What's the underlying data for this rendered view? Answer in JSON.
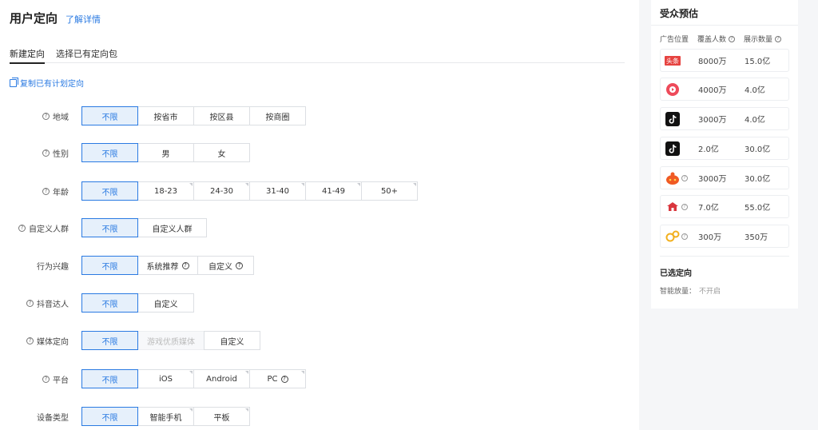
{
  "header": {
    "title": "用户定向",
    "learn_more": "了解详情"
  },
  "tabs": [
    {
      "label": "新建定向"
    },
    {
      "label": "选择已有定向包"
    }
  ],
  "copy_link": "复制已有计划定向",
  "rows": {
    "region": {
      "label": "地域",
      "options": [
        "不限",
        "按省市",
        "按区县",
        "按商圈"
      ]
    },
    "gender": {
      "label": "性别",
      "options": [
        "不限",
        "男",
        "女"
      ]
    },
    "age": {
      "label": "年龄",
      "options": [
        "不限",
        "18-23",
        "24-30",
        "31-40",
        "41-49",
        "50+"
      ]
    },
    "custom_crowd": {
      "label": "自定义人群",
      "options": [
        "不限",
        "自定义人群"
      ]
    },
    "behavior": {
      "label": "行为兴趣",
      "options": [
        "不限",
        "系统推荐",
        "自定义"
      ]
    },
    "douyin_kol": {
      "label": "抖音达人",
      "options": [
        "不限",
        "自定义"
      ]
    },
    "media": {
      "label": "媒体定向",
      "options": [
        "不限",
        "游戏优质媒体",
        "自定义"
      ]
    },
    "platform": {
      "label": "平台",
      "options": [
        "不限",
        "iOS",
        "Android",
        "PC"
      ]
    },
    "device": {
      "label": "设备类型",
      "options": [
        "不限",
        "智能手机",
        "平板"
      ]
    }
  },
  "help_glyph": "?",
  "audience": {
    "title": "受众预估",
    "col_position": "广告位置",
    "col_cover": "覆盖人数",
    "col_show": "展示数量",
    "rows": [
      {
        "logo": "toutiao-logo",
        "logo_text": "头条",
        "cover": "8000万",
        "show": "15.0亿"
      },
      {
        "logo": "xigua-logo",
        "cover": "4000万",
        "show": "4.0亿"
      },
      {
        "logo": "douyin-logo",
        "cover": "3000万",
        "show": "4.0亿"
      },
      {
        "logo": "douyin-logo",
        "cover": "2.0亿",
        "show": "30.0亿"
      },
      {
        "logo": "huoshan-logo",
        "cover": "3000万",
        "show": "30.0亿"
      },
      {
        "logo": "union-logo",
        "cover": "7.0亿",
        "show": "55.0亿"
      },
      {
        "logo": "other-logo",
        "cover": "300万",
        "show": "350万"
      }
    ],
    "selected_title": "已选定向",
    "smart_label": "智能放量：",
    "smart_value": "不开启"
  },
  "colors": {
    "accent": "#2a7ae2",
    "toutiao": "#e64340",
    "xigua": "#ee4a5a",
    "douyin": "#111111",
    "huoshan": "#f05a24",
    "gold": "#f2b01e"
  }
}
